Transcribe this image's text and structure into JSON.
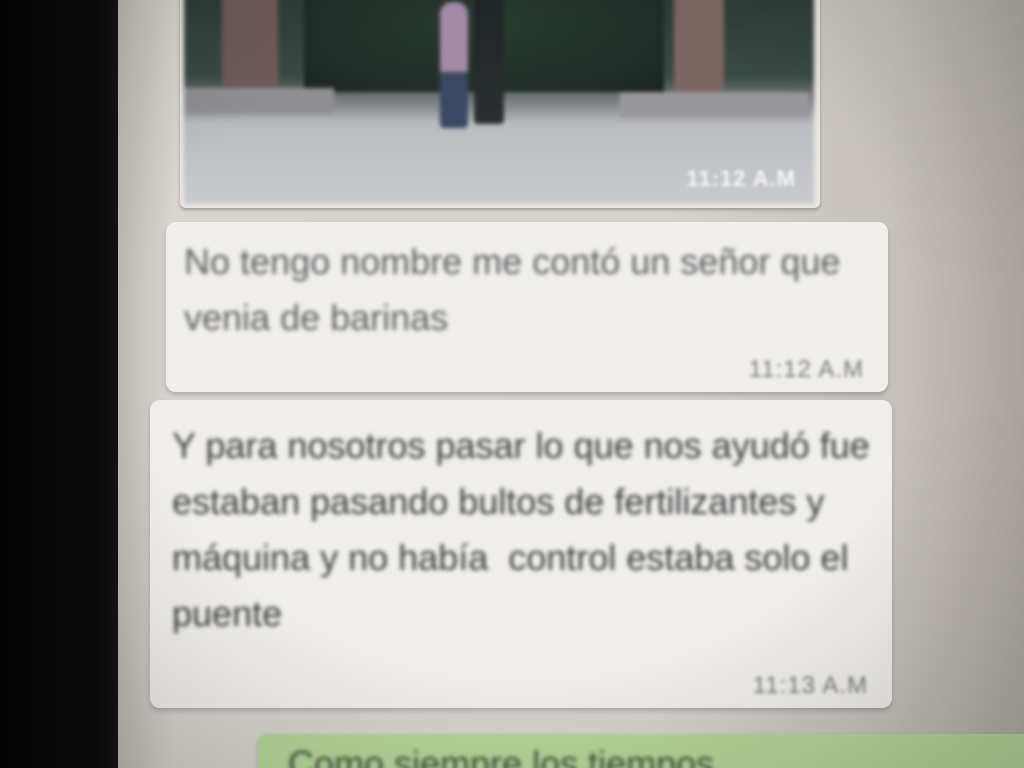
{
  "chat": {
    "photo_message": {
      "time": "11:12 A.M"
    },
    "messages": [
      {
        "text": "No tengo nombre me contó un señor que venia de barinas",
        "time": "11:12 A.M"
      },
      {
        "text": "Y para nosotros pasar lo que nos ayudó fue estaban pasando bultos de fertilizantes y máquina y no había  control estaba solo el puente",
        "time": "11:13 A.M"
      }
    ],
    "outgoing_partial": {
      "text": "Como siempre los tiempos"
    }
  },
  "colors": {
    "incoming_bubble": "#f1efec",
    "outgoing_bubble": "#b6d79a",
    "background": "#d6d2cc"
  }
}
